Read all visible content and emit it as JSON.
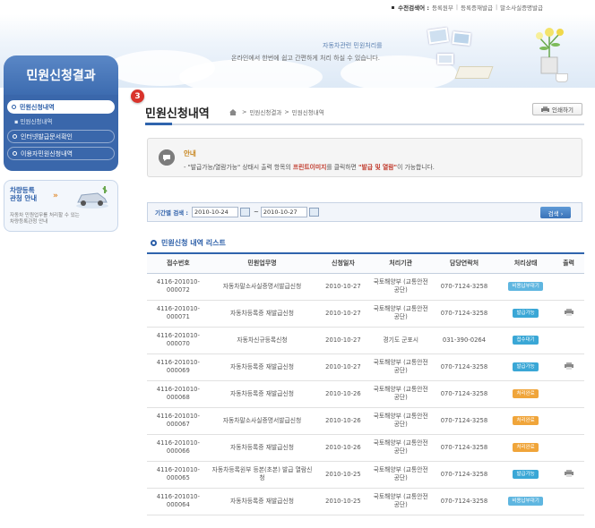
{
  "topbar": {
    "label": "수전검색어 :",
    "links": [
      "등록원부",
      "등록증재발급",
      "말소사실증명발급"
    ]
  },
  "banner": {
    "line1": "자동차관련 민원처리를",
    "line2_prefix": "온라인에서 한번에 쉽고 간편하게 처리 하실 수 있습니다."
  },
  "sidebar": {
    "title": "민원신청결과",
    "items": [
      {
        "label": "민원신청내역",
        "active": true
      },
      {
        "label": "인터넷발급문서확인",
        "active": false
      },
      {
        "label": "이용자민원신청내역",
        "active": false
      }
    ],
    "sub_item": "민원신청내역",
    "promo": {
      "heading1": "차량등록",
      "heading2": "관청 안내",
      "arrow": "»",
      "desc1": "자동차 민원업무를 처리할 수 있는",
      "desc2": "차량등록관청 안내"
    }
  },
  "main": {
    "step_number": "3",
    "page_title": "민원신청내역",
    "breadcrumb": [
      "홈",
      "민원신청결과",
      "민원신청내역"
    ],
    "print_label": "인쇄하기",
    "notice": {
      "heading": "안내",
      "text_pre": "- \"발급가능/열람가능\" 상태시 출력 항목의 ",
      "text_red1": "프린트이미지",
      "text_mid": "를 클릭하면 ",
      "text_red2": "\"발급 및 열람\"",
      "text_post": "이 가능합니다."
    },
    "search": {
      "label": "기간별 검색 :",
      "date_from": "2010-10-24",
      "date_to": "2010-10-27",
      "tilde": "~",
      "button": "검색 ›"
    },
    "list_heading": "민원신청 내역 리스트"
  },
  "table": {
    "headers": [
      "접수번호",
      "민원업무명",
      "신청일자",
      "처리기관",
      "담당연락처",
      "처리상태",
      "출력"
    ],
    "rows": [
      {
        "receipt": "4116-201010-000072",
        "task": "자동차말소사실증명서발급신청",
        "date": "2010-10-27",
        "org": "국토해양부 (교통안전공단)",
        "contact": "070-7124-3258",
        "status": "비용납부대기",
        "status_color": "#5fb6e0",
        "printable": false
      },
      {
        "receipt": "4116-201010-000071",
        "task": "자동차등록증 재발급신청",
        "date": "2010-10-27",
        "org": "국토해양부 (교통안전공단)",
        "contact": "070-7124-3258",
        "status": "발급가능",
        "status_color": "#3aa7d6",
        "printable": true
      },
      {
        "receipt": "4116-201010-000070",
        "task": "자동차신규등록신청",
        "date": "2010-10-27",
        "org": "경기도 군포시",
        "contact": "031-390-0264",
        "status": "접수대기",
        "status_color": "#3aa7d6",
        "printable": false
      },
      {
        "receipt": "4116-201010-000069",
        "task": "자동차등록증 재발급신청",
        "date": "2010-10-27",
        "org": "국토해양부 (교통안전공단)",
        "contact": "070-7124-3258",
        "status": "발급가능",
        "status_color": "#3aa7d6",
        "printable": true
      },
      {
        "receipt": "4116-201010-000068",
        "task": "자동차등록증 재발급신청",
        "date": "2010-10-26",
        "org": "국토해양부 (교통안전공단)",
        "contact": "070-7124-3258",
        "status": "처리완료",
        "status_color": "#f0a53a",
        "printable": false
      },
      {
        "receipt": "4116-201010-000067",
        "task": "자동차말소사실증명서발급신청",
        "date": "2010-10-26",
        "org": "국토해양부 (교통안전공단)",
        "contact": "070-7124-3258",
        "status": "처리완료",
        "status_color": "#f0a53a",
        "printable": false
      },
      {
        "receipt": "4116-201010-000066",
        "task": "자동차등록증 재발급신청",
        "date": "2010-10-26",
        "org": "국토해양부 (교통안전공단)",
        "contact": "070-7124-3258",
        "status": "처리완료",
        "status_color": "#f0a53a",
        "printable": false
      },
      {
        "receipt": "4116-201010-000065",
        "task": "자동차등록원부 등본(초본) 발급 열람신청",
        "date": "2010-10-25",
        "org": "국토해양부 (교통안전공단)",
        "contact": "070-7124-3258",
        "status": "발급가능",
        "status_color": "#3aa7d6",
        "printable": true
      },
      {
        "receipt": "4116-201010-000064",
        "task": "자동차등록증 재발급신청",
        "date": "2010-10-25",
        "org": "국토해양부 (교통안전공단)",
        "contact": "070-7124-3258",
        "status": "비용납부대기",
        "status_color": "#5fb6e0",
        "printable": false
      }
    ]
  }
}
